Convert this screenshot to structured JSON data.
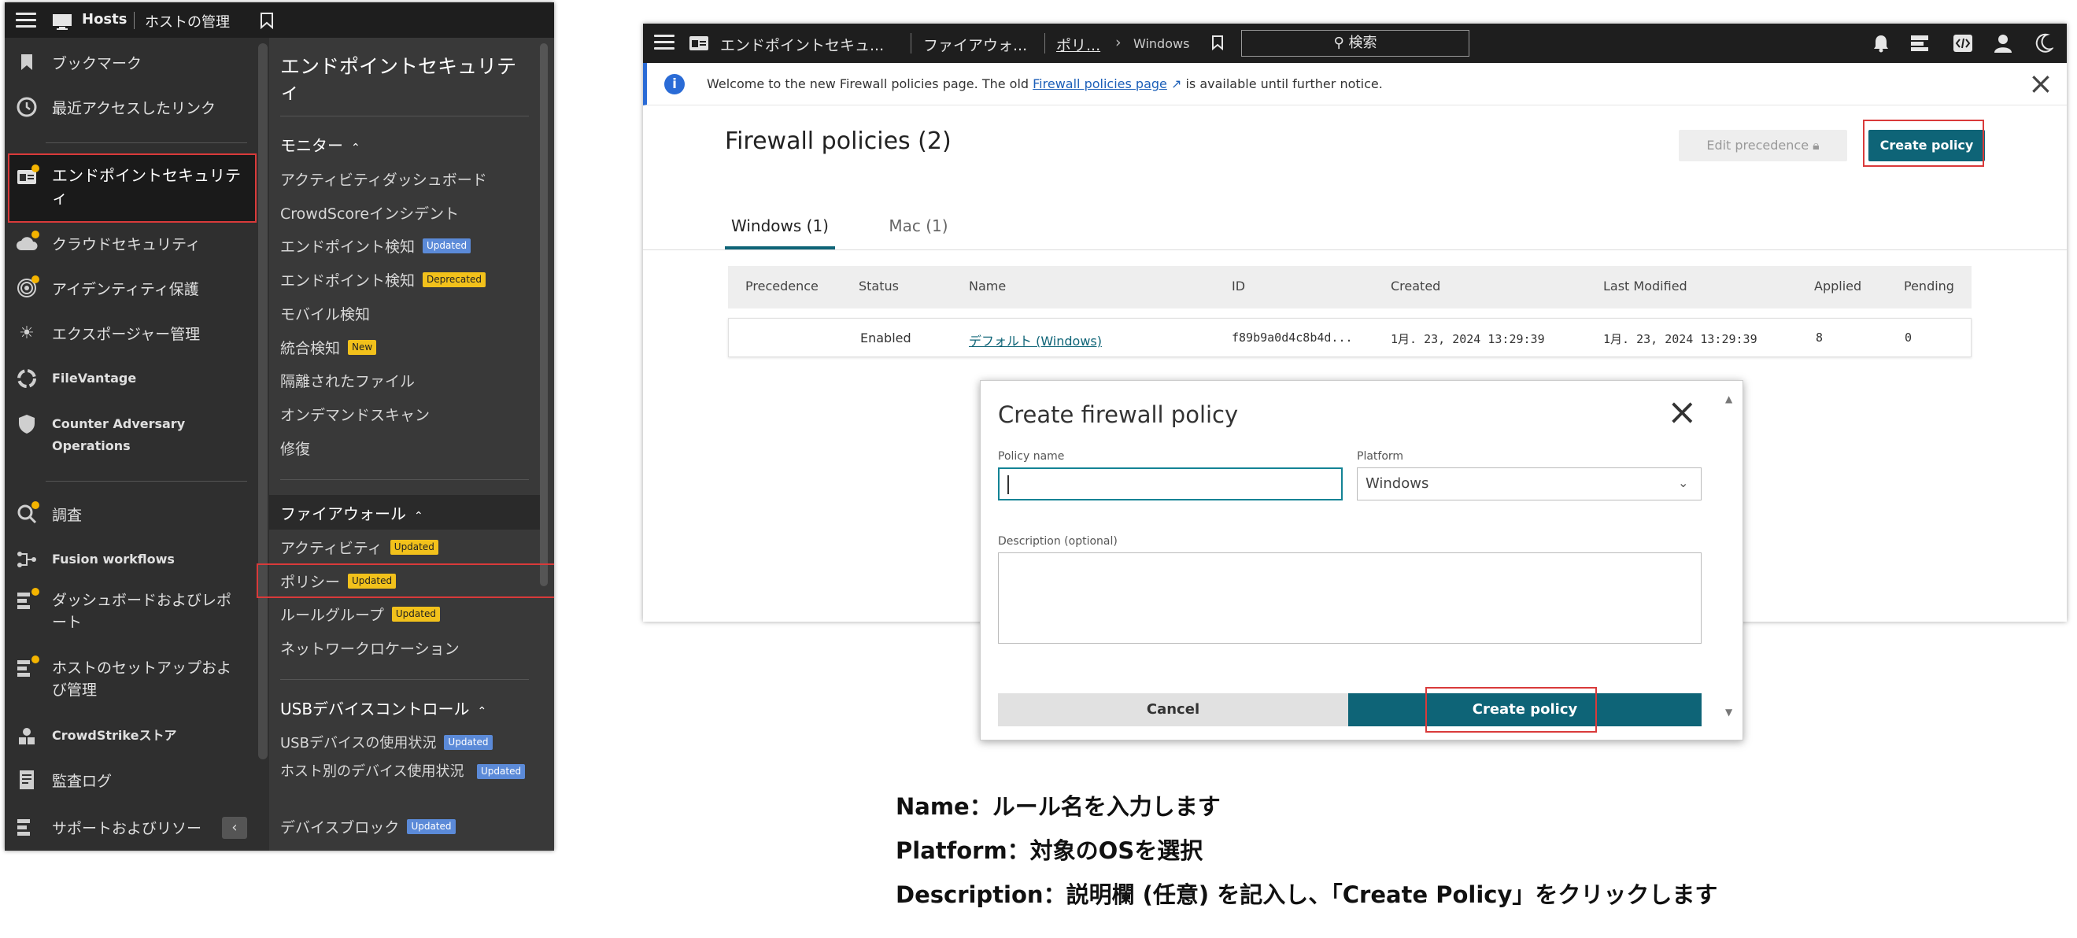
{
  "left_panel": {
    "header": {
      "title": "Hosts",
      "subtitle": "ホストの管理"
    },
    "primary_nav": [
      {
        "label": "ブックマーク",
        "icon": "bookmark-icon"
      },
      {
        "label": "最近アクセスしたリンク",
        "icon": "history-icon"
      },
      {
        "label": "エンドポイントセキュリティ",
        "icon": "endpoint-security-icon",
        "selected": true
      },
      {
        "label": "クラウドセキュリティ",
        "icon": "cloud-icon"
      },
      {
        "label": "アイデンティティ保護",
        "icon": "fingerprint-icon"
      },
      {
        "label": "エクスポージャー管理",
        "icon": "sun-icon"
      },
      {
        "label": "FileVantage",
        "icon": "filevantage-icon"
      },
      {
        "label": "Counter Adversary Operations",
        "icon": "counter-adversary-icon"
      },
      {
        "label": "調査",
        "icon": "investigate-icon"
      },
      {
        "label": "Fusion workflows",
        "icon": "workflow-icon"
      },
      {
        "label": "ダッシュボードおよびレポート",
        "icon": "dashboard-icon"
      },
      {
        "label": "ホストのセットアップおよび管理",
        "icon": "host-setup-icon"
      },
      {
        "label": "CrowdStrikeストア",
        "icon": "store-icon"
      },
      {
        "label": "監査ログ",
        "icon": "audit-log-icon"
      },
      {
        "label": "サポートおよびリソー",
        "icon": "support-icon"
      }
    ],
    "secondary": {
      "title": "エンドポイントセキュリティ",
      "sections": [
        {
          "title": "モニター",
          "items": [
            {
              "label": "アクティビティダッシュボード",
              "badge": ""
            },
            {
              "label": "CrowdScoreインシデント",
              "badge": ""
            },
            {
              "label": "エンドポイント検知",
              "badge": "Updated"
            },
            {
              "label": "エンドポイント検知",
              "badge": "Deprecated"
            },
            {
              "label": "モバイル検知",
              "badge": ""
            },
            {
              "label": "統合検知",
              "badge": "New"
            },
            {
              "label": "隔離されたファイル",
              "badge": ""
            },
            {
              "label": "オンデマンドスキャン",
              "badge": ""
            },
            {
              "label": "修復",
              "badge": ""
            }
          ]
        },
        {
          "title": "ファイアウォール",
          "items": [
            {
              "label": "アクティビティ",
              "badge": "Updated"
            },
            {
              "label": "ポリシー",
              "badge": "Updated"
            },
            {
              "label": "ルールグループ",
              "badge": "Updated"
            },
            {
              "label": "ネットワークロケーション",
              "badge": ""
            }
          ]
        },
        {
          "title": "USBデバイスコントロール",
          "items": [
            {
              "label": "USBデバイスの使用状況",
              "badge": "Updated"
            },
            {
              "label": "ホスト別のデバイス使用状況",
              "badge": "Updated"
            },
            {
              "label": "デバイスブロック",
              "badge": "Updated"
            }
          ]
        }
      ]
    }
  },
  "app": {
    "topbar": {
      "breadcrumbs": [
        "エンドポイントセキュ...",
        "ファイアウォ...",
        "ポリ...",
        "Windows"
      ],
      "search_label": "検索"
    },
    "banner": {
      "prefix": "Welcome to the new Firewall policies page. The old ",
      "link": "Firewall policies page",
      "suffix": " is available until further notice."
    },
    "page_title": "Firewall policies (2)",
    "edit_precedence_label": "Edit precedence",
    "create_policy_label": "Create policy",
    "tabs": [
      "Windows (1)",
      "Mac (1)"
    ],
    "table": {
      "columns": [
        "Precedence",
        "Status",
        "Name",
        "ID",
        "Created",
        "Last Modified",
        "Applied",
        "Pending"
      ],
      "rows": [
        {
          "precedence": "",
          "status": "Enabled",
          "name": "デフォルト (Windows)",
          "id": "f89b9a0d4c8b4d...",
          "created": "1月. 23, 2024 13:29:39",
          "last_modified": "1月. 23, 2024 13:29:39",
          "applied": "8",
          "pending": "0"
        }
      ]
    }
  },
  "dialog": {
    "title": "Create firewall policy",
    "policy_name_label": "Policy name",
    "policy_name_value": "",
    "platform_label": "Platform",
    "platform_value": "Windows",
    "description_label": "Description (optional)",
    "cancel_label": "Cancel",
    "create_label": "Create policy"
  },
  "notes": [
    "Name：ルール名を入力します",
    "Platform：対象のOSを選択",
    "Description：説明欄 (任意) を記入し、「Create Policy」をクリックします"
  ],
  "colors": {
    "accent": "#0e6477",
    "highlight": "#d93a3a",
    "badge_yellow": "#f2c11b",
    "badge_blue": "#5b8ad8"
  }
}
